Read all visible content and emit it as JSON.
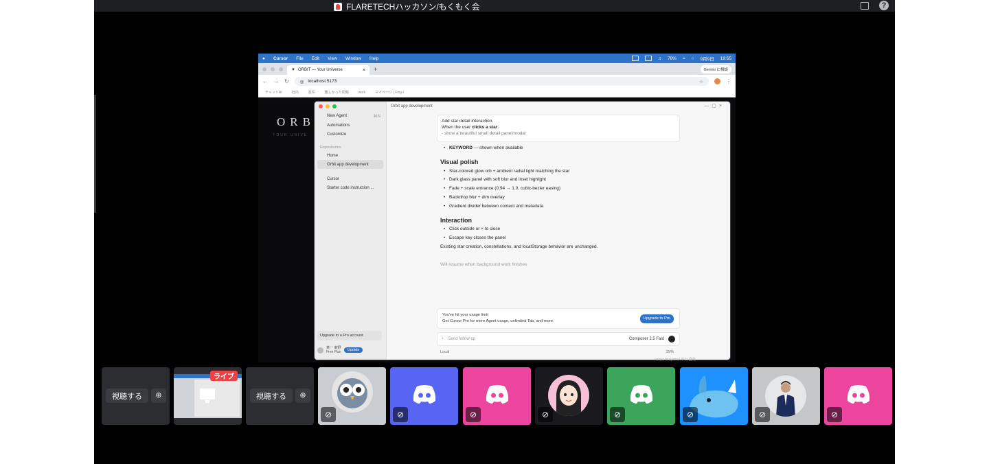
{
  "window": {
    "title": "FLARETECHハッカソン/もくもく会"
  },
  "screen": {
    "menubar": {
      "apple": "",
      "app": "Cursor",
      "items": [
        "File",
        "Edit",
        "View",
        "Window",
        "Help"
      ],
      "battery": "78%",
      "date": "9月9日",
      "time": "19:55"
    },
    "browser": {
      "tab_title": "ORBIT — Your Universe",
      "url": "localhost:5173",
      "gemini_label": "Gemini に相談",
      "bookmarks": [
        "チャットAI",
        "社内",
        "案件",
        "難しかった問題",
        "work",
        "マイページ | Fing-i"
      ]
    },
    "orbit": {
      "logo": "ORB",
      "sub": "YOUR UNIVE"
    },
    "cursor": {
      "sidebar": {
        "items": [
          "New Agent",
          "Automations",
          "Customize"
        ],
        "new_agent_shortcut": "⌘N",
        "repos_label": "Repositories",
        "repo_items": [
          "Home",
          "Orbit app development"
        ],
        "second_items": [
          "Cursor",
          "Starter code instruction ..."
        ],
        "upgrade": "Upgrade to a Pro account",
        "user": "黄一 東野",
        "plan": "Free Plan",
        "update_btn": "Update"
      },
      "title": "Orbit app development",
      "prompt": {
        "line1": "Add star detail interaction.",
        "line2_pre": "When the user ",
        "line2_bold": "clicks a star",
        "line2_post": ":",
        "line3": "- show a beautiful small detail panel/modal"
      },
      "keyword_line_bold": "KEYWORD",
      "keyword_line_rest": " — shown when available",
      "visual_heading": "Visual polish",
      "visual_items": [
        "Star-colored glow orb + ambient radial light matching the star",
        "Dark glass panel with soft blur and inset highlight",
        "Fade + scale entrance (0.94 → 1.0, cubic-bezier easing)",
        "Backdrop blur + dim overlay",
        "Gradient divider between content and metadata"
      ],
      "interaction_heading": "Interaction",
      "interaction_items": [
        "Click outside or × to close",
        "Escape key closes the panel"
      ],
      "summary": "Existing star creation, constellations, and localStorage behavior are unchanged.",
      "resume": "Will resume when background work finishes",
      "limit": {
        "title": "You've hit your usage limit",
        "desc": "Get Cursor Pro for more Agent usage, unlimited Tab, and more.",
        "button": "Upgrade to Pro"
      },
      "input_placeholder": "Send follow-up",
      "model": "Composer 2.5 Fast",
      "local": "Local",
      "percent": "29%"
    },
    "name_tag": "naoya hirayama/ 平山 直哉"
  },
  "tiles": {
    "watch_label": "視聴する",
    "live_label": "ライブ",
    "colors": {
      "blurple": "#5865f2",
      "pink": "#eb459e",
      "green": "#3ba55c",
      "dark": "#2b2d31",
      "blue": "#1e90ff"
    }
  }
}
